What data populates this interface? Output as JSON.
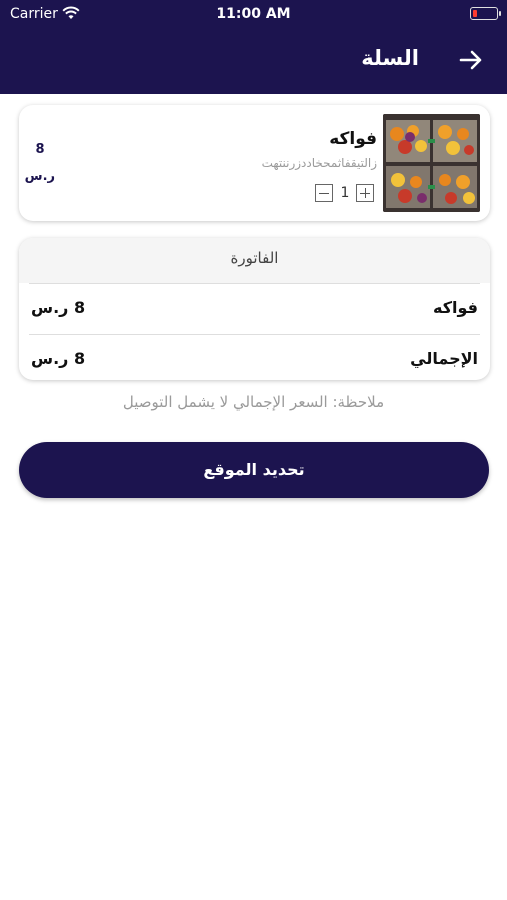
{
  "status_bar": {
    "carrier": "Carrier",
    "time": "11:00 AM"
  },
  "header": {
    "title": "السلة",
    "back_icon": "arrow-right-icon"
  },
  "cart_item": {
    "name": "فواكه",
    "description": "زالتيقفاثمحخاددزرننتهت",
    "quantity": "1",
    "price": "8",
    "currency": "ر.س"
  },
  "invoice": {
    "title": "الفاتورة",
    "rows": [
      {
        "label": "فواكه",
        "value": "8 ر.س"
      },
      {
        "label": "الإجمالي",
        "value": "8 ر.س"
      }
    ]
  },
  "note": "ملاحظة: السعر الإجمالي لا يشمل التوصيل",
  "cta_label": "تحديد الموقع",
  "colors": {
    "primary": "#1c144f",
    "battery_low": "#ff3b30"
  }
}
